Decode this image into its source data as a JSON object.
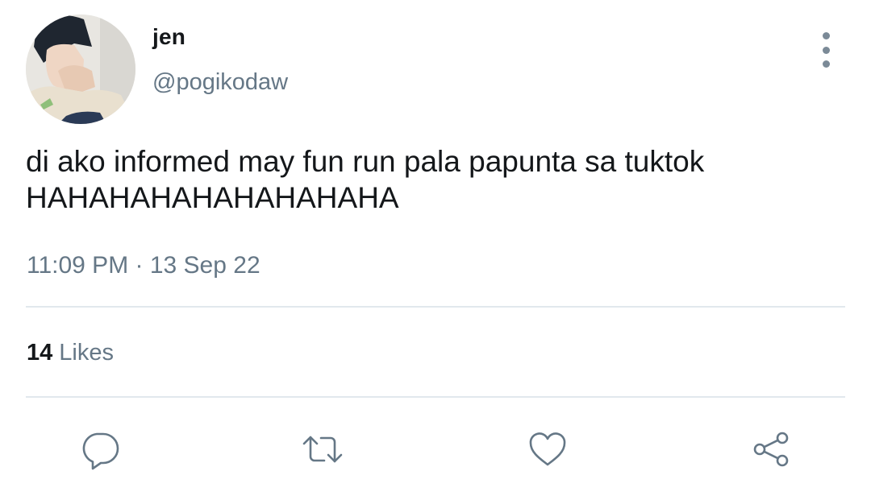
{
  "tweet": {
    "author": {
      "display_name": "jen",
      "handle": "@pogikodaw"
    },
    "text": "di ako informed may fun run pala papunta sa tuktok\nHAHAHAHAHAHAHAHAHA",
    "timestamp": "11:09 PM · 13 Sep 22",
    "stats": {
      "likes_count": "14",
      "likes_label": "Likes"
    }
  },
  "actions": {
    "reply_icon": "reply-icon",
    "retweet_icon": "retweet-icon",
    "like_icon": "heart-icon",
    "share_icon": "share-icon",
    "more_icon": "more-vertical-icon"
  },
  "colors": {
    "text_primary": "#14171a",
    "text_secondary": "#657786",
    "divider": "#e1e8ed",
    "icon": "#657786"
  }
}
